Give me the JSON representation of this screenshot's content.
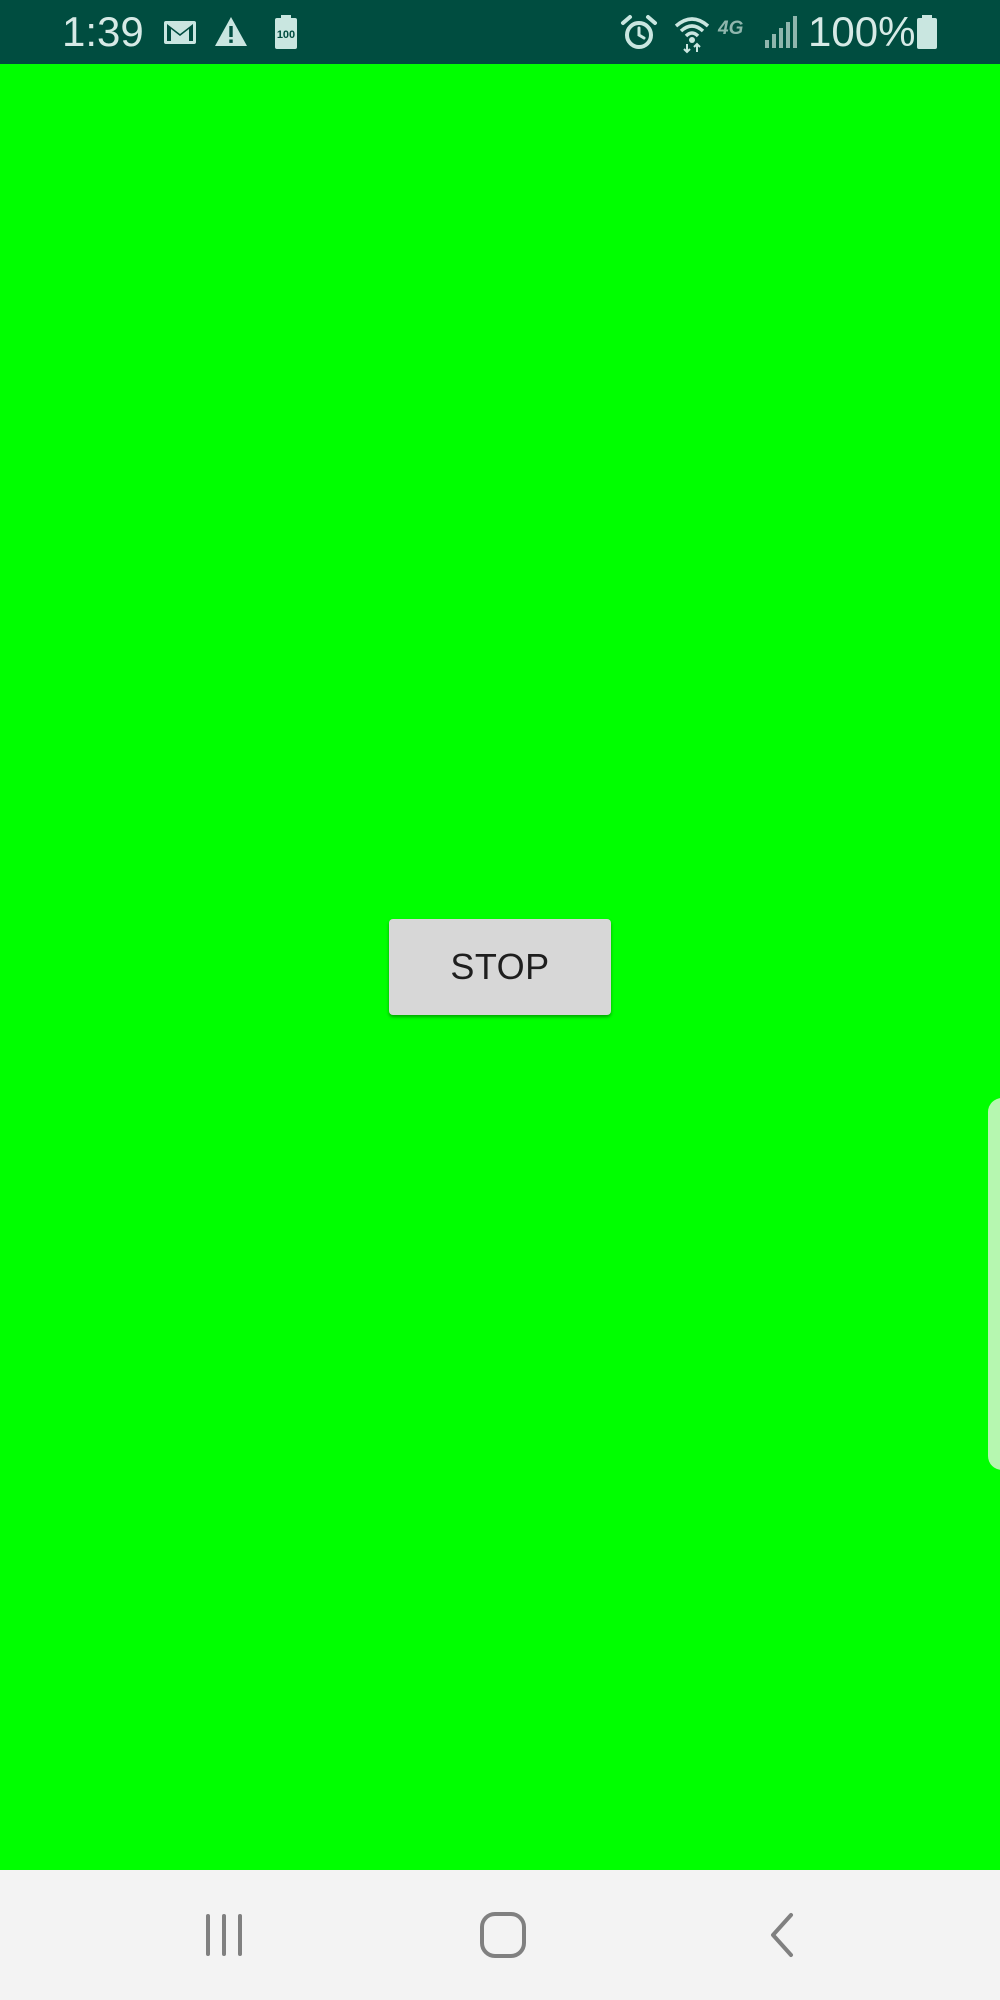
{
  "status_bar": {
    "time": "1:39",
    "battery_percent": "100%",
    "left_icons": [
      "gmail-icon",
      "warning-icon",
      "battery-saver-icon"
    ],
    "right_icons": [
      "alarm-icon",
      "wifi-icon",
      "lte-icon",
      "signal-icon",
      "battery-icon"
    ],
    "battery_saver_label": "100",
    "network_label": "4G"
  },
  "main": {
    "background_color": "#00FF00",
    "stop_button_label": "STOP"
  },
  "nav_bar": {
    "buttons": [
      "recent-apps",
      "home",
      "back"
    ]
  },
  "colors": {
    "status_bar_bg": "#004D40",
    "button_bg": "#D7D7D7",
    "nav_bar_bg": "#F3F3F3"
  }
}
